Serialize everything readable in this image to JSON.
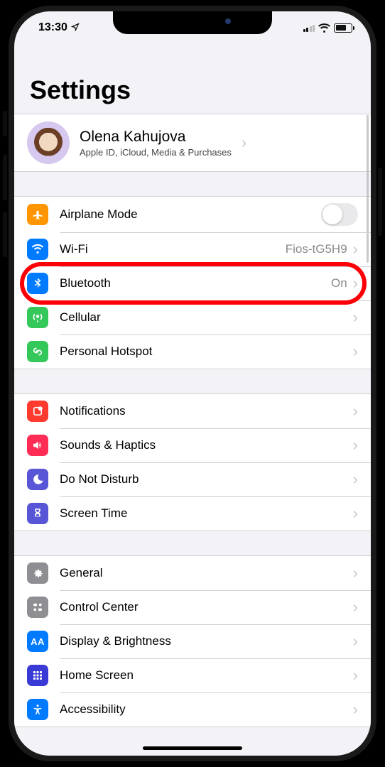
{
  "status": {
    "time": "13:30"
  },
  "title": "Settings",
  "profile": {
    "name": "Olena Kahujova",
    "sub": "Apple ID, iCloud, Media & Purchases"
  },
  "group1": {
    "airplane": {
      "label": "Airplane Mode"
    },
    "wifi": {
      "label": "Wi-Fi",
      "value": "Fios-tG5H9"
    },
    "bluetooth": {
      "label": "Bluetooth",
      "value": "On"
    },
    "cellular": {
      "label": "Cellular"
    },
    "hotspot": {
      "label": "Personal Hotspot"
    }
  },
  "group2": {
    "notifications": {
      "label": "Notifications"
    },
    "sounds": {
      "label": "Sounds & Haptics"
    },
    "dnd": {
      "label": "Do Not Disturb"
    },
    "screentime": {
      "label": "Screen Time"
    }
  },
  "group3": {
    "general": {
      "label": "General"
    },
    "controlcenter": {
      "label": "Control Center"
    },
    "display": {
      "label": "Display & Brightness"
    },
    "homescreen": {
      "label": "Home Screen"
    },
    "accessibility": {
      "label": "Accessibility"
    }
  }
}
